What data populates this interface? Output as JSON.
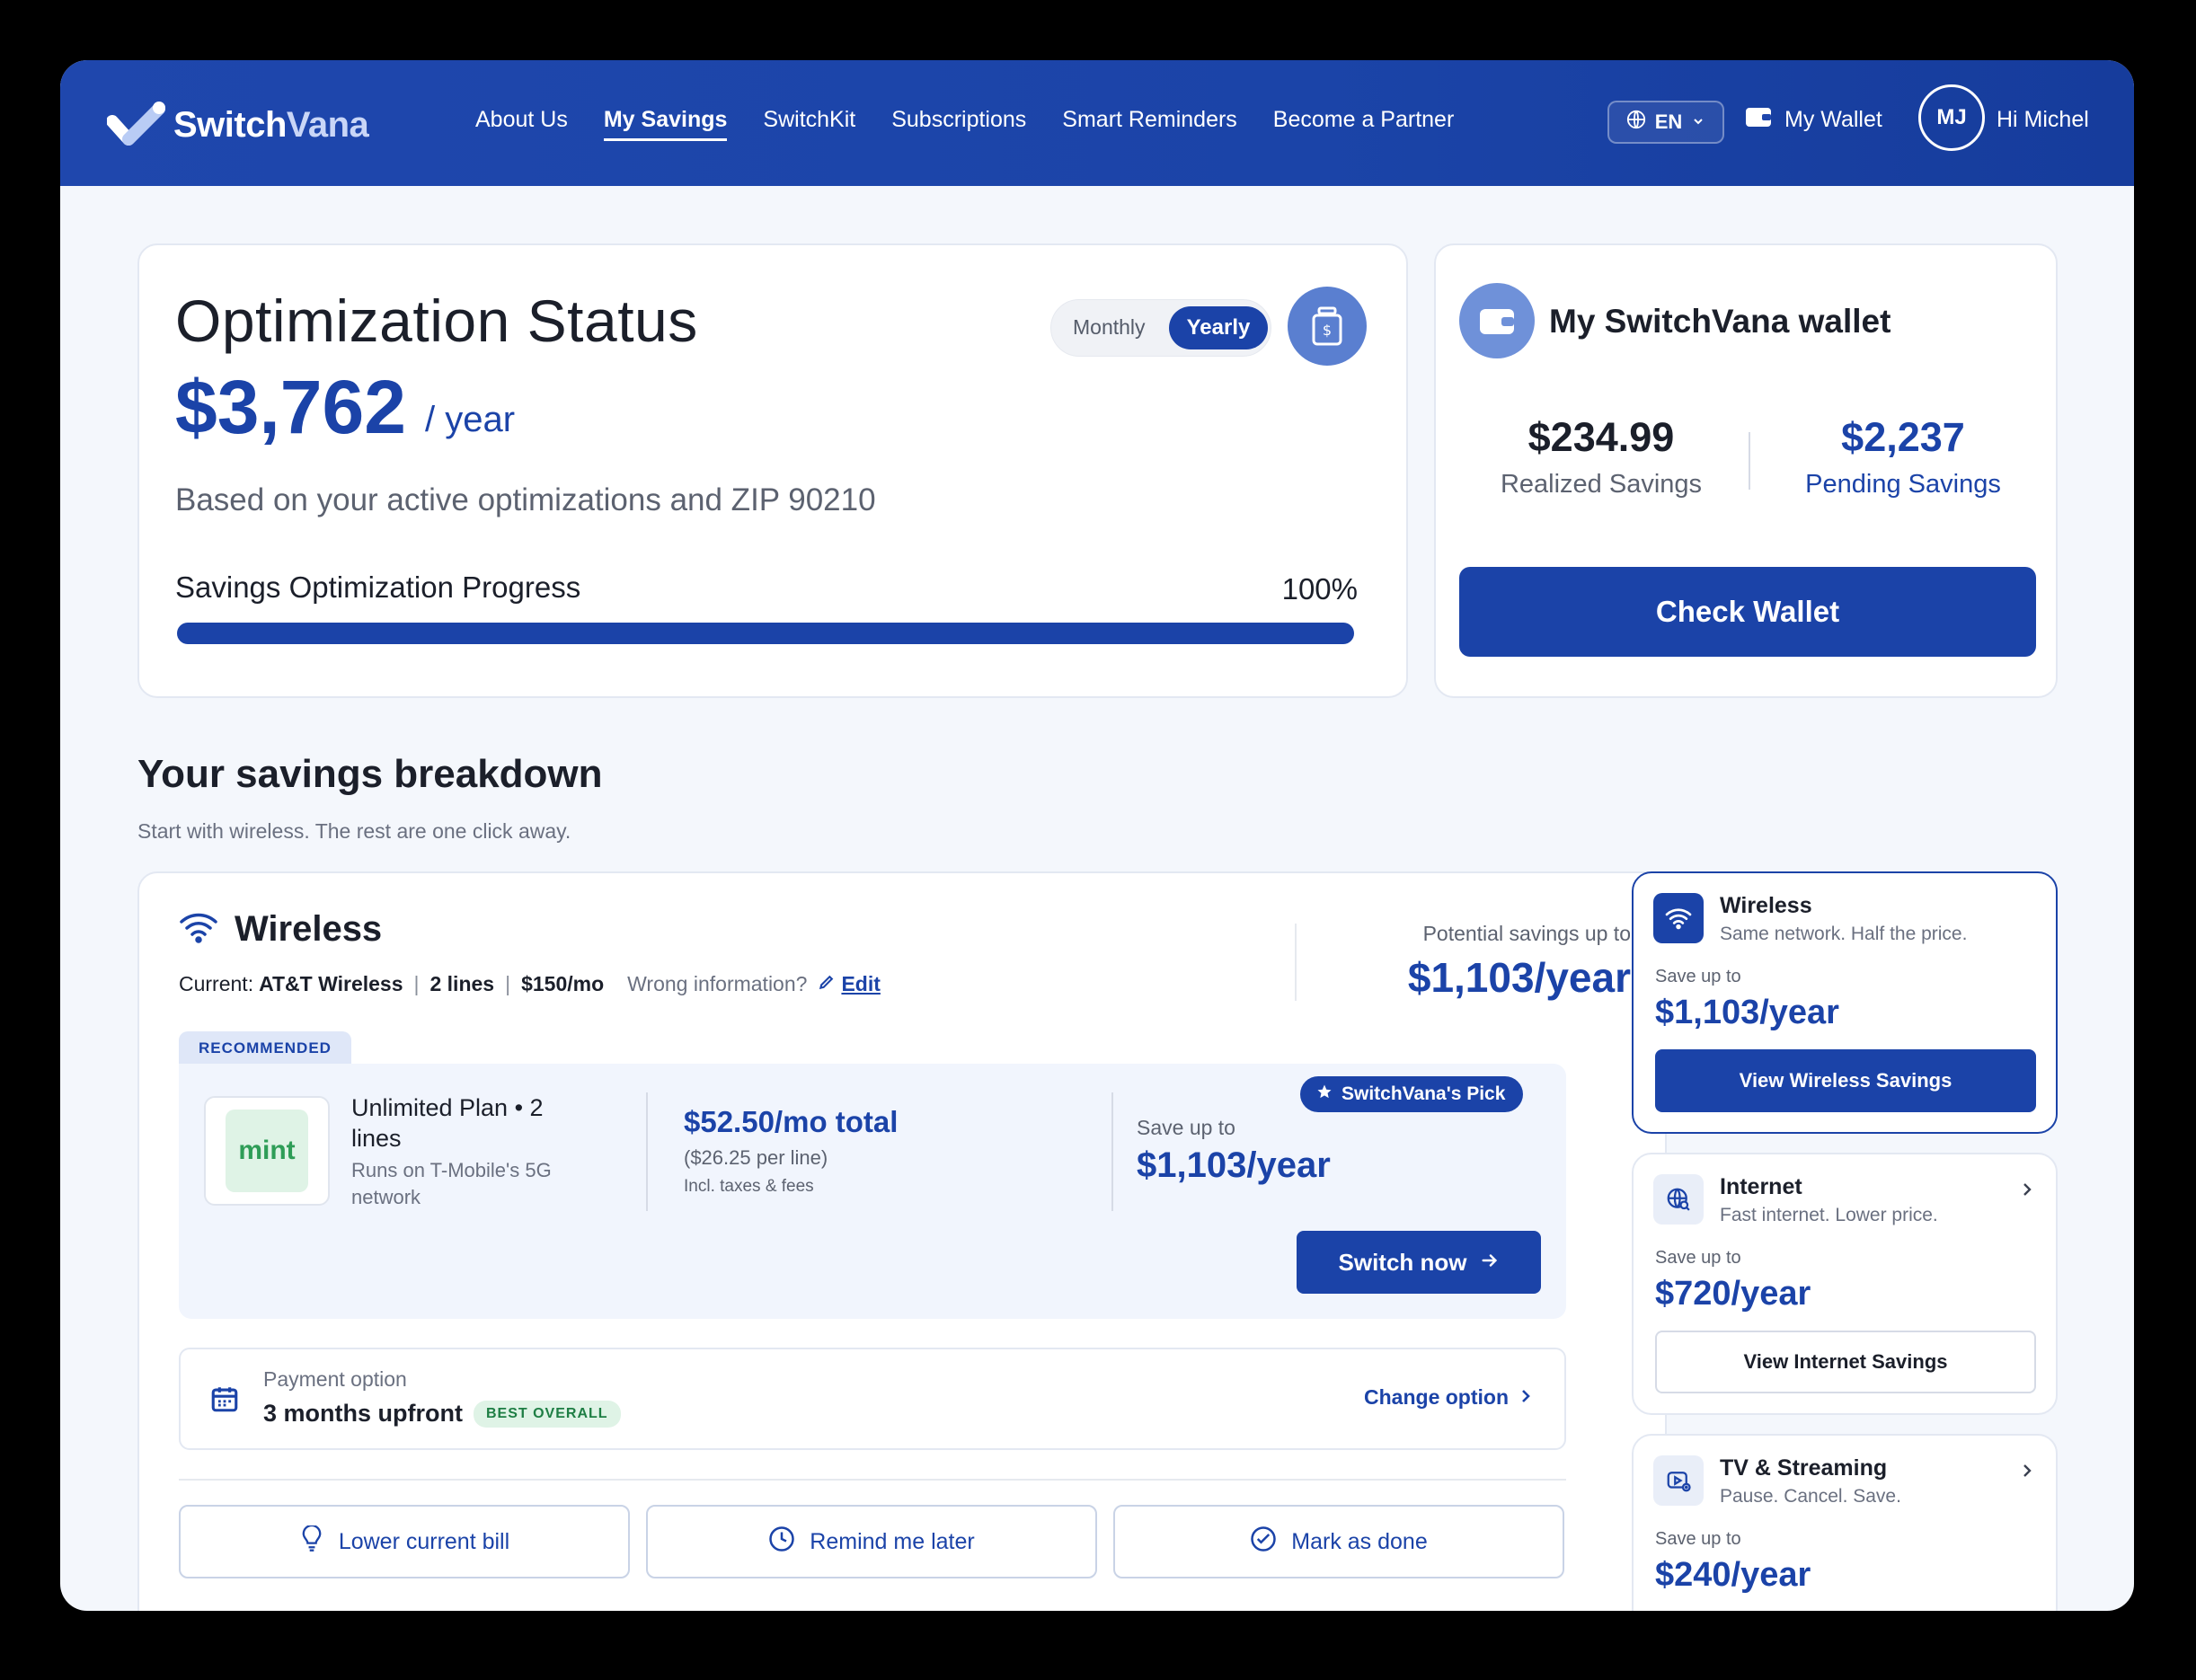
{
  "brand": {
    "name_part1": "Switch",
    "name_part2": "Vana"
  },
  "nav": [
    "About Us",
    "My Savings",
    "SwitchKit",
    "Subscriptions",
    "Smart Reminders",
    "Become a Partner"
  ],
  "nav_active": "My Savings",
  "header": {
    "language": "EN",
    "wallet_label": "My Wallet",
    "avatar_initials": "MJ",
    "greeting": "Hi Michel"
  },
  "optimization": {
    "title": "Optimization Status",
    "amount": "$3,762",
    "period": "/ year",
    "subtitle": "Based on your active optimizations and ZIP 90210",
    "toggle_monthly": "Monthly",
    "toggle_yearly": "Yearly",
    "toggle_selected": "Yearly",
    "progress_label": "Savings Optimization Progress",
    "progress_text": "100%",
    "progress_value": 100
  },
  "wallet": {
    "title": "My SwitchVana wallet",
    "realized_value": "$234.99",
    "realized_label": "Realized Savings",
    "pending_value": "$2,237",
    "pending_label": "Pending Savings",
    "button": "Check Wallet"
  },
  "breakdown": {
    "title": "Your savings breakdown",
    "subtitle": "Start with wireless. The rest are one click away."
  },
  "wireless": {
    "title": "Wireless",
    "current_label": "Current:",
    "current_provider": "AT&T Wireless",
    "lines": "2 lines",
    "price": "$150/mo",
    "wrong_info": "Wrong information?",
    "edit": "Edit",
    "potential_label": "Potential savings up to",
    "potential_value": "$1,103/year",
    "recommended_tag": "RECOMMENDED",
    "offer": {
      "logo_text": "mint",
      "plan_name": "Unlimited Plan • 2 lines",
      "plan_sub": "Runs on T-Mobile's 5G network",
      "price_total": "$52.50/mo total",
      "price_per_line": "($26.25 per line)",
      "price_note": "Incl. taxes & fees",
      "save_label": "Save up to",
      "save_value": "$1,103/year",
      "pick_badge": "SwitchVana's Pick",
      "switch_button": "Switch now"
    },
    "payment": {
      "label": "Payment option",
      "value": "3 months upfront",
      "badge": "BEST OVERALL",
      "change": "Change option"
    },
    "actions": [
      "Lower current bill",
      "Remind me later",
      "Mark as done"
    ]
  },
  "side_cards": [
    {
      "title": "Wireless",
      "subtitle": "Same network. Half the price.",
      "save_label": "Save up to",
      "save_value": "$1,103/year",
      "button": "View Wireless Savings",
      "icon": "wifi-icon"
    },
    {
      "title": "Internet",
      "subtitle": "Fast internet. Lower price.",
      "save_label": "Save up to",
      "save_value": "$720/year",
      "button": "View Internet Savings",
      "icon": "globe-icon"
    },
    {
      "title": "TV & Streaming",
      "subtitle": "Pause. Cancel. Save.",
      "save_label": "Save up to",
      "save_value": "$240/year",
      "icon": "tv-icon"
    }
  ],
  "colors": {
    "brand_blue": "#1b43a8",
    "header_blue": "#1f47ad",
    "success_green": "#1e7e44",
    "page_bg": "#f4f7fc"
  }
}
